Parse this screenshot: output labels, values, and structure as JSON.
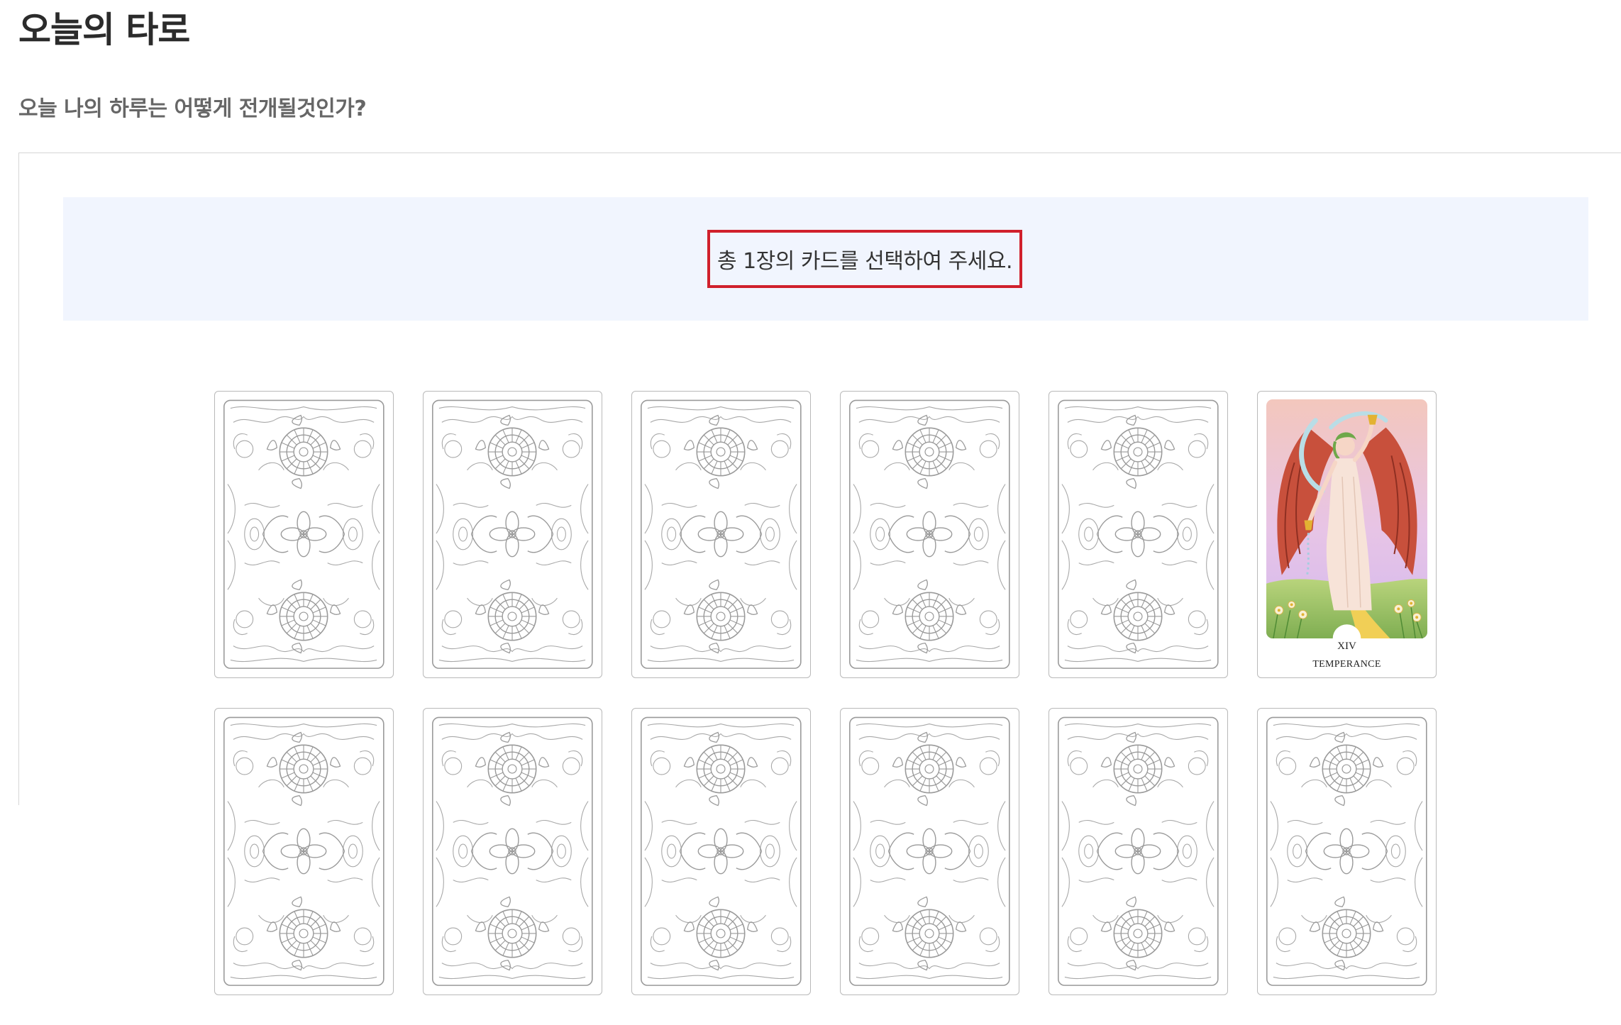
{
  "page": {
    "title": "오늘의 타로",
    "subtitle": "오늘 나의 하루는 어떻게 전개될것인가?"
  },
  "instruction": {
    "text": "총 1장의 카드를 선택하여 주세요."
  },
  "cards": {
    "revealed": {
      "numeral": "XIV",
      "name": "TEMPERANCE"
    }
  },
  "colors": {
    "highlight_border": "#d0202c",
    "banner_background": "#f1f5fe",
    "card_line": "#9a9a9a"
  }
}
